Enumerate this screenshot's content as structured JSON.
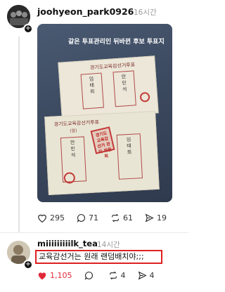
{
  "post": {
    "username": "joohyeon_park0926",
    "time": "16시간",
    "photo_caption": "같은 투표관리인 뒤바뀐 후보 투표지",
    "ballot_top": {
      "title": "경기도교육감선거투표",
      "candidates": [
        "임태희",
        "안민석"
      ]
    },
    "ballot_bottom": {
      "title": "경기도교육감선거투표",
      "subtitle": "(앞)",
      "candidates": [
        "안민석",
        "임태희"
      ],
      "seal_text": "경기도 교육감 선거 관리 위원회"
    },
    "stats": {
      "likes": "295",
      "comments": "71",
      "reposts": "61",
      "shares": "19"
    }
  },
  "reply": {
    "username": "miiiiiiiiilk_tea",
    "time": "14시간",
    "text": "교육감선거는 원래 랜덤배치야;;;",
    "stats": {
      "likes": "1,105",
      "comments": "",
      "reposts": "4",
      "shares": "4"
    }
  },
  "colors": {
    "like_active": "#e02a3a",
    "highlight_box": "#e02020"
  },
  "icons": [
    "plus-icon",
    "heart-icon",
    "comment-icon",
    "repost-icon",
    "share-icon"
  ]
}
